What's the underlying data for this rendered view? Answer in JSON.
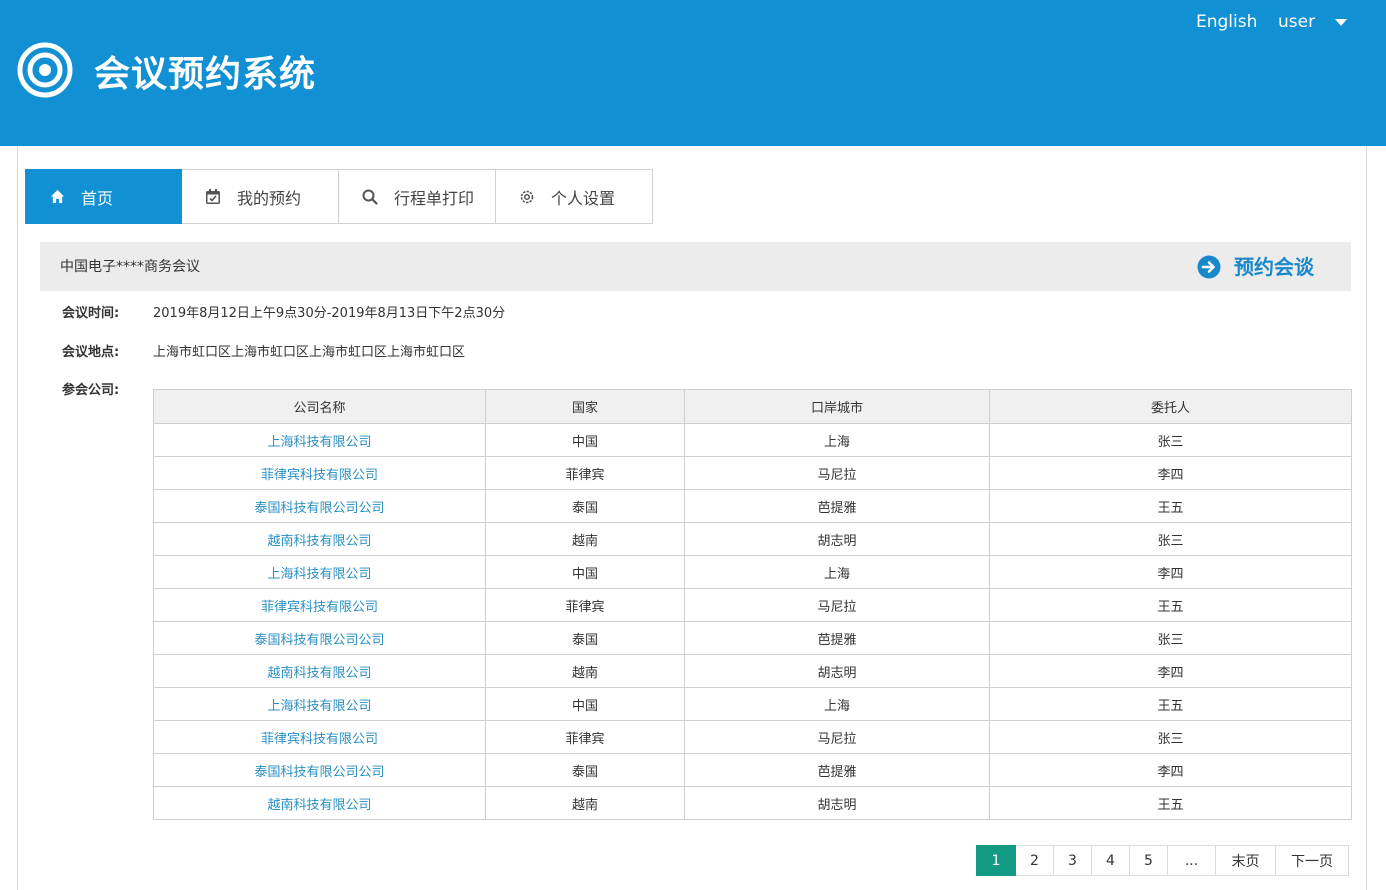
{
  "header": {
    "title": "会议预约系统",
    "language_link": "English",
    "user_label": "user"
  },
  "tabs": [
    {
      "label": "首页",
      "icon": "home-icon",
      "active": true
    },
    {
      "label": "我的预约",
      "icon": "calendar-icon",
      "active": false
    },
    {
      "label": "行程单打印",
      "icon": "search-icon",
      "active": false
    },
    {
      "label": "个人设置",
      "icon": "gear-icon",
      "active": false
    }
  ],
  "meeting": {
    "name": "中国电子****商务会议",
    "book_button": "预约会谈",
    "time_label": "会议时间:",
    "time_value": "2019年8月12日上午9点30分-2019年8月13日下午2点30分",
    "location_label": "会议地点:",
    "location_value": "上海市虹口区上海市虹口区上海市虹口区上海市虹口区",
    "companies_label": "参会公司:"
  },
  "table": {
    "headers": [
      "公司名称",
      "国家",
      "口岸城市",
      "委托人"
    ],
    "rows": [
      [
        "上海科技有限公司",
        "中国",
        "上海",
        "张三"
      ],
      [
        "菲律宾科技有限公司",
        "菲律宾",
        "马尼拉",
        "李四"
      ],
      [
        "泰国科技有限公司公司",
        "泰国",
        "芭提雅",
        "王五"
      ],
      [
        "越南科技有限公司",
        "越南",
        "胡志明",
        "张三"
      ],
      [
        "上海科技有限公司",
        "中国",
        "上海",
        "李四"
      ],
      [
        "菲律宾科技有限公司",
        "菲律宾",
        "马尼拉",
        "王五"
      ],
      [
        "泰国科技有限公司公司",
        "泰国",
        "芭提雅",
        "张三"
      ],
      [
        "越南科技有限公司",
        "越南",
        "胡志明",
        "李四"
      ],
      [
        "上海科技有限公司",
        "中国",
        "上海",
        "王五"
      ],
      [
        "菲律宾科技有限公司",
        "菲律宾",
        "马尼拉",
        "张三"
      ],
      [
        "泰国科技有限公司公司",
        "泰国",
        "芭提雅",
        "李四"
      ],
      [
        "越南科技有限公司",
        "越南",
        "胡志明",
        "王五"
      ]
    ]
  },
  "pagination": {
    "pages": [
      "1",
      "2",
      "3",
      "4",
      "5",
      "..."
    ],
    "current": "1",
    "last_label": "末页",
    "next_label": "下一页"
  },
  "colors": {
    "header_bg": "#1190d3",
    "link": "#2a8fc4",
    "active_page": "#129a84"
  }
}
